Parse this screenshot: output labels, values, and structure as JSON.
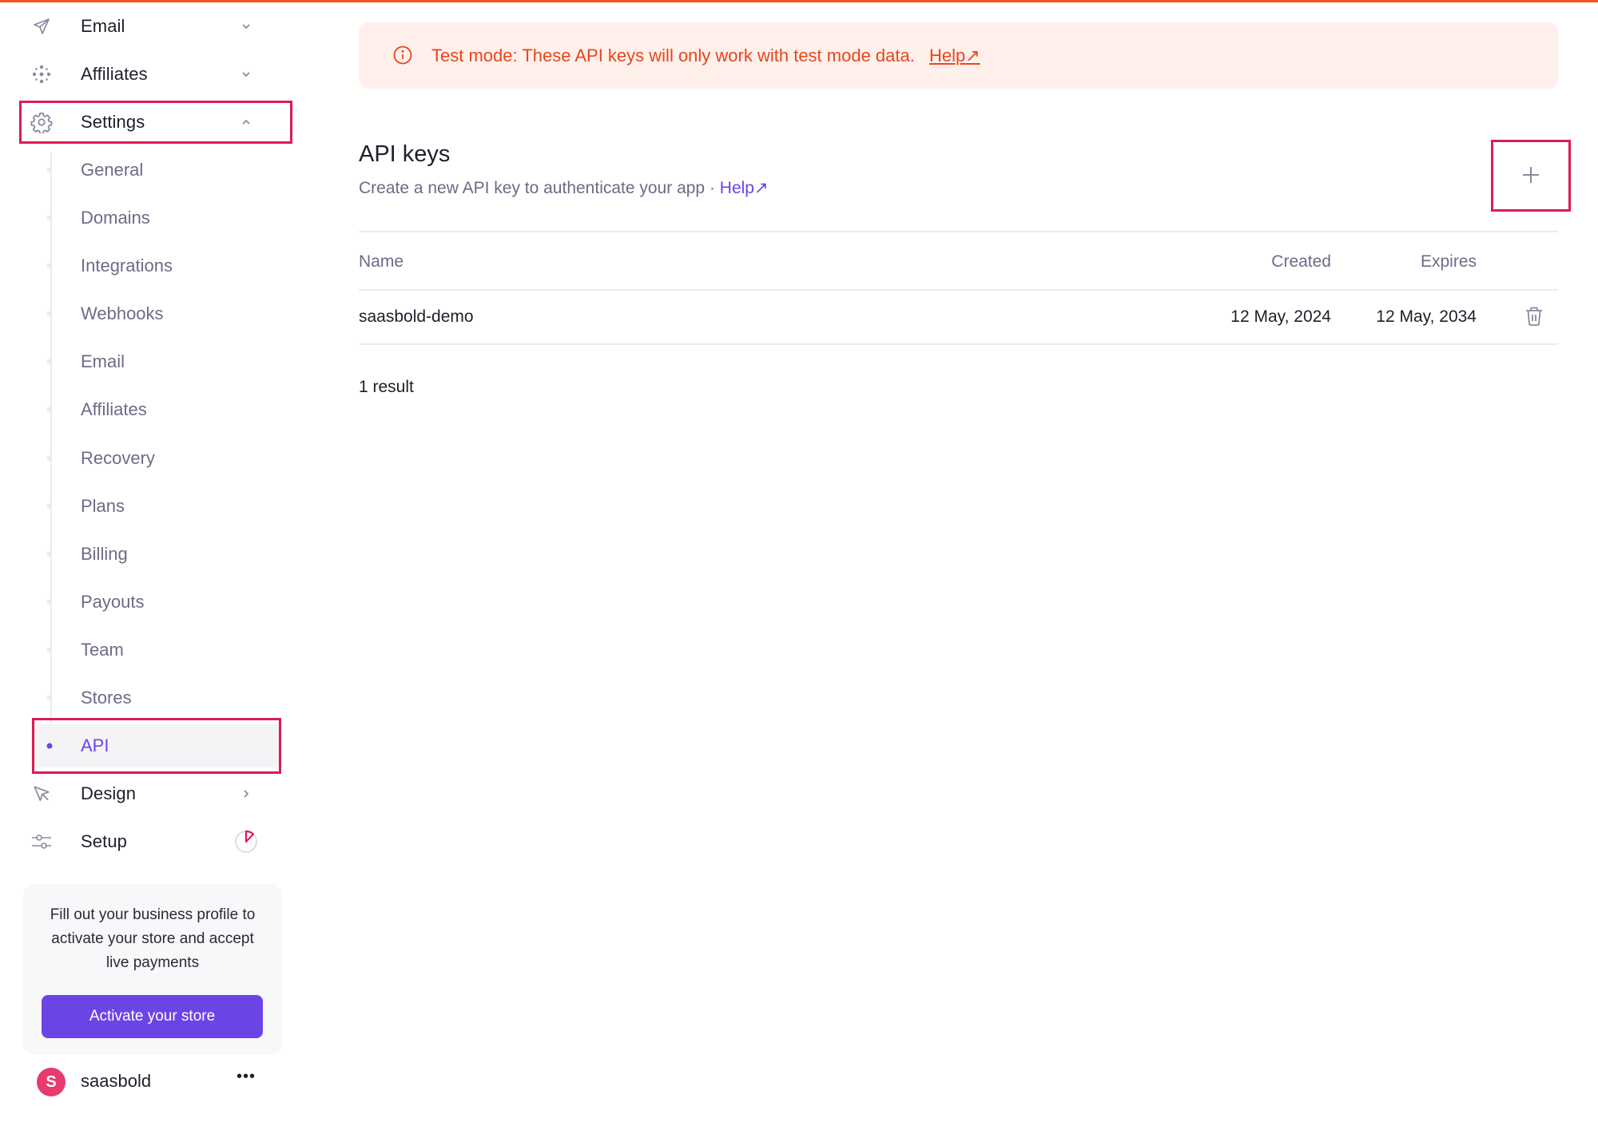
{
  "colors": {
    "accent": "#6c44e6",
    "highlight": "#dc1c52",
    "warning_text": "#e8461a",
    "warning_bg": "#fff0ec",
    "topbar": "#f2541d",
    "avatar": "#e83a6d"
  },
  "sidebar": {
    "top_items": [
      {
        "label": "Email",
        "icon": "send-icon",
        "chevron": "chevron-down"
      },
      {
        "label": "Affiliates",
        "icon": "dots-network-icon",
        "chevron": "chevron-down"
      },
      {
        "label": "Settings",
        "icon": "gear-icon",
        "chevron": "chevron-up"
      }
    ],
    "settings_sub_items": [
      {
        "label": "General"
      },
      {
        "label": "Domains"
      },
      {
        "label": "Integrations"
      },
      {
        "label": "Webhooks"
      },
      {
        "label": "Email"
      },
      {
        "label": "Affiliates"
      },
      {
        "label": "Recovery"
      },
      {
        "label": "Plans"
      },
      {
        "label": "Billing"
      },
      {
        "label": "Payouts"
      },
      {
        "label": "Team"
      },
      {
        "label": "Stores"
      },
      {
        "label": "API",
        "active": true
      }
    ],
    "bottom_items": [
      {
        "label": "Design",
        "icon": "cursor-arrow-icon",
        "chevron": "chevron-right"
      },
      {
        "label": "Setup",
        "icon": "sliders-icon",
        "progress_fraction": 0.12
      }
    ],
    "activation_card": {
      "text": "Fill out your business profile to activate your store and accept live payments",
      "button_label": "Activate your store"
    },
    "user": {
      "avatar_letter": "S",
      "name": "saasbold",
      "menu_icon": "more-horizontal-icon"
    }
  },
  "banner": {
    "text": "Test mode: These API keys will only work with test mode data.",
    "link_label": "Help",
    "link_icon": "arrow-up-right-icon",
    "icon": "info-icon"
  },
  "page": {
    "title": "API keys",
    "subtitle": "Create a new API key to authenticate your app ·",
    "help_label": "Help",
    "add_button_icon": "plus-icon"
  },
  "table": {
    "columns": [
      "Name",
      "Created",
      "Expires"
    ],
    "rows": [
      {
        "name": "saasbold-demo",
        "created": "12 May, 2024",
        "expires": "12 May, 2034",
        "action_icon": "trash-icon"
      }
    ],
    "result_count": "1 result"
  }
}
